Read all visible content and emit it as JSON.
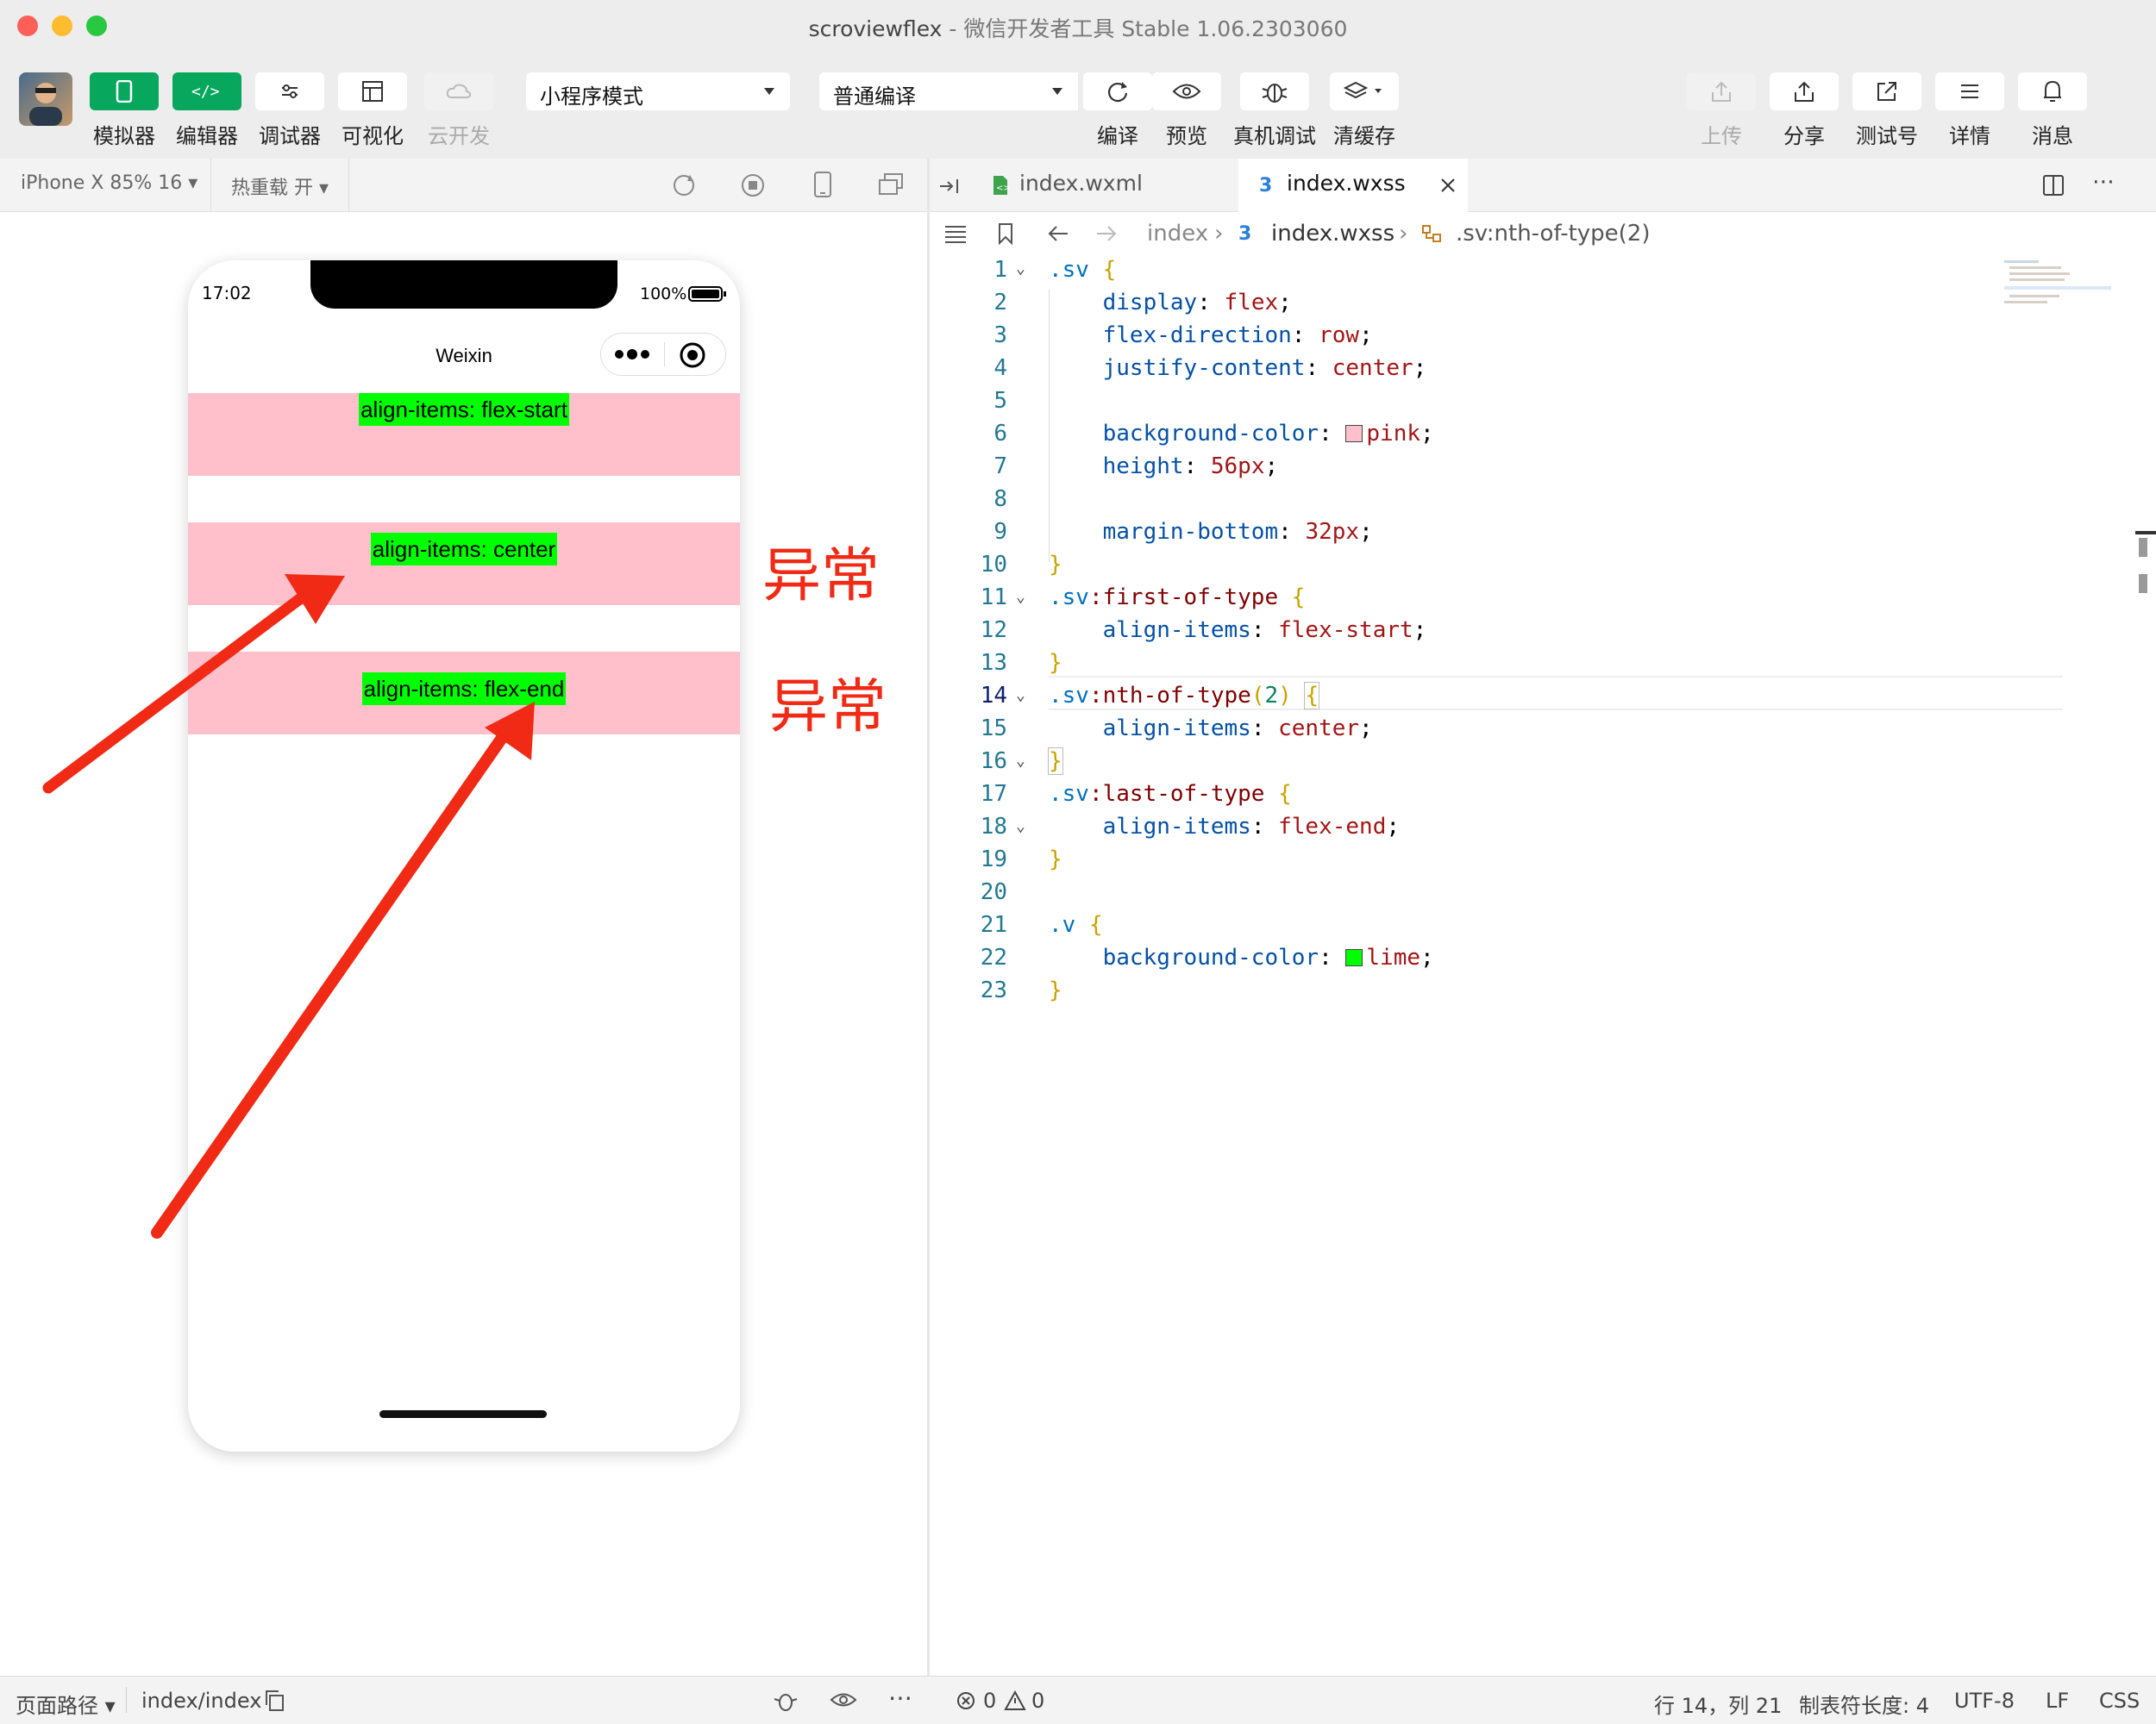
{
  "window": {
    "title_main": "scroviewflex",
    "title_sub": " - 微信开发者工具 Stable 1.06.2303060"
  },
  "toolbar": {
    "simulator": "模拟器",
    "editor": "编辑器",
    "debugger": "调试器",
    "visual": "可视化",
    "cloud": "云开发",
    "mode": "小程序模式",
    "compile_mode": "普通编译",
    "compile": "编译",
    "preview": "预览",
    "real_debug": "真机调试",
    "clear_cache": "清缓存",
    "upload": "上传",
    "share": "分享",
    "test_account": "测试号",
    "details": "详情",
    "messages": "消息"
  },
  "simbar": {
    "device": "iPhone X 85% 16 ▾",
    "hot_reload": "热重载 开 ▾"
  },
  "phone": {
    "time": "17:02",
    "battery": "100%",
    "nav_title": "Weixin",
    "items": [
      {
        "label": "align-items: flex-start"
      },
      {
        "label": "align-items: center"
      },
      {
        "label": "align-items: flex-end"
      }
    ]
  },
  "annotations": {
    "label1": "异常",
    "label2": "异常",
    "color": "#f02a14"
  },
  "editor": {
    "tabs": [
      {
        "label": "index.wxml"
      },
      {
        "label": "index.wxss"
      }
    ],
    "breadcrumb": {
      "part1": "index",
      "part2": "index.wxss",
      "part3": ".sv:nth-of-type(2)"
    },
    "line_numbers": [
      "1",
      "2",
      "3",
      "4",
      "5",
      "6",
      "7",
      "8",
      "9",
      "10",
      "11",
      "12",
      "13",
      "14",
      "15",
      "16",
      "17",
      "18",
      "19",
      "20",
      "21",
      "22",
      "23"
    ]
  },
  "statusbar": {
    "page_path": "页面路径 ▾",
    "path": "index/index",
    "errors": "0",
    "warnings": "0",
    "cursor": "行 14，列 21",
    "tab_size": "制表符长度: 4",
    "encoding": "UTF-8",
    "eol": "LF",
    "lang": "CSS"
  }
}
